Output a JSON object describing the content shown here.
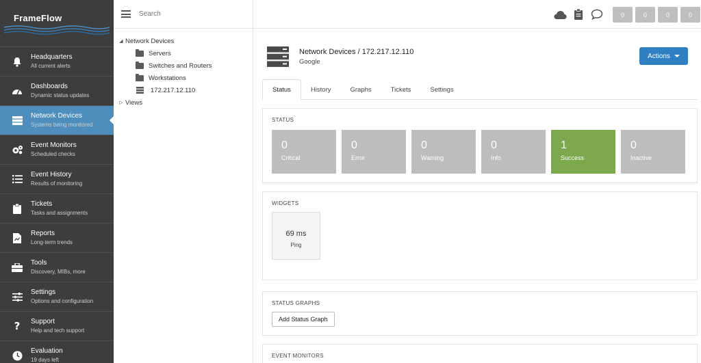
{
  "app": {
    "name": "FrameFlow"
  },
  "sidebar": {
    "items": [
      {
        "title": "Headquarters",
        "subtitle": "All current alerts",
        "icon": "bell-icon"
      },
      {
        "title": "Dashboards",
        "subtitle": "Dynamic status updates",
        "icon": "gauge-icon"
      },
      {
        "title": "Network Devices",
        "subtitle": "Systems being monitored",
        "icon": "server-icon",
        "active": true
      },
      {
        "title": "Event Monitors",
        "subtitle": "Scheduled checks",
        "icon": "gears-icon"
      },
      {
        "title": "Event History",
        "subtitle": "Results of monitoring",
        "icon": "list-icon"
      },
      {
        "title": "Tickets",
        "subtitle": "Tasks and assignments",
        "icon": "clipboard-icon"
      },
      {
        "title": "Reports",
        "subtitle": "Long-term trends",
        "icon": "report-icon"
      },
      {
        "title": "Tools",
        "subtitle": "Discovery, MIBs, more",
        "icon": "toolbox-icon"
      },
      {
        "title": "Settings",
        "subtitle": "Options and configuration",
        "icon": "sliders-icon"
      },
      {
        "title": "Support",
        "subtitle": "Help and tech support",
        "icon": "question-icon"
      },
      {
        "title": "Evaluation",
        "subtitle": "19 days left",
        "icon": "clock-icon"
      }
    ]
  },
  "search": {
    "placeholder": "Search"
  },
  "tree": {
    "root": "Network Devices",
    "children": [
      "Servers",
      "Switches and Routers",
      "Workstations",
      "172.217.12.110"
    ],
    "views": "Views"
  },
  "topbar": {
    "badges": [
      "0",
      "0",
      "0",
      "0"
    ]
  },
  "device": {
    "title": "Network Devices / 172.217.12.110",
    "subtitle": "Google"
  },
  "actions": {
    "label": "Actions"
  },
  "tabs": [
    "Status",
    "History",
    "Graphs",
    "Tickets",
    "Settings"
  ],
  "status": {
    "title": "STATUS",
    "tiles": [
      {
        "count": "0",
        "label": "Critical"
      },
      {
        "count": "0",
        "label": "Error"
      },
      {
        "count": "0",
        "label": "Warning"
      },
      {
        "count": "0",
        "label": "Info"
      },
      {
        "count": "1",
        "label": "Success"
      },
      {
        "count": "0",
        "label": "Inactive"
      }
    ]
  },
  "widgets": {
    "title": "WIDGETS",
    "ping_value": "69 ms",
    "ping_label": "Ping"
  },
  "status_graphs": {
    "title": "STATUS GRAPHS",
    "button": "Add Status Graph"
  },
  "event_monitors": {
    "title": "EVENT MONITORS"
  },
  "colors": {
    "sidebar_bg": "#3d3d3d",
    "active_nav": "#4e8ebd",
    "accent_button": "#2f80c3",
    "success": "#7ca84e",
    "tile_gray": "#bdbdbd"
  }
}
